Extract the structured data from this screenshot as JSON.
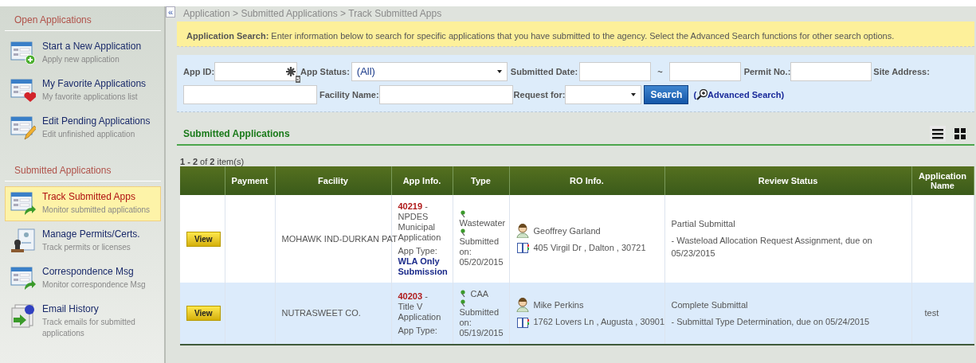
{
  "sidebar": {
    "sections": [
      {
        "title": "Open Applications",
        "items": [
          {
            "kind": "add",
            "title": "Start a New Application",
            "subtitle": "Apply new application",
            "selected": false
          },
          {
            "kind": "favorite",
            "title": "My Favorite Applications",
            "subtitle": "My favorite applications list",
            "selected": false
          },
          {
            "kind": "edit",
            "title": "Edit Pending Applications",
            "subtitle": "Edit unfinished application",
            "selected": false
          }
        ]
      },
      {
        "title": "Submitted Applications",
        "items": [
          {
            "kind": "track",
            "title": "Track Submitted Apps",
            "subtitle": "Monitor submitted applications",
            "selected": true
          },
          {
            "kind": "permit",
            "title": "Manage Permits/Certs.",
            "subtitle": "Track permits or licenses",
            "selected": false
          },
          {
            "kind": "track",
            "title": "Correspondence Msg",
            "subtitle": "Monitor correspondence Msg",
            "selected": false
          },
          {
            "kind": "email",
            "title": "Email History",
            "subtitle": "Track emails for submitted applications",
            "selected": false
          }
        ]
      }
    ]
  },
  "collapse_button": "«",
  "breadcrumb": "Application > Submitted Applications > Track Submitted Apps",
  "notice": "**Application Search:** Enter information below to search for specific applications that you have submitted to the agency. Select the Advanced Search functions for other search options.",
  "search": {
    "app_id_label": "App ID:",
    "app_id_badge": "5",
    "app_status_label": "App Status:",
    "app_status_value": "(All)",
    "submitted_date_label": "Submitted Date:",
    "date_separator": "~",
    "permit_no_label": "Permit No.:",
    "site_address_label": "Site Address:",
    "facility_name_label": "Facility Name:",
    "request_for_label": "Request for:",
    "search_button": "Search",
    "open_paren": "(",
    "advanced_search": "Advanced Search",
    "close_paren": ")"
  },
  "section_title": "Submitted Applications",
  "item_count": "**1 - 2** of **2** item(s)",
  "table": {
    "columns": [
      "",
      "Payment",
      "Facility",
      "App Info.",
      "Type",
      "RO Info.",
      "Review Status",
      "Application Name"
    ],
    "rows": [
      {
        "action": "View",
        "facility": "MOHAWK IND-DURKAN PAT",
        "app_id": "40219",
        "app_title": " - NPDES Municipal Application",
        "app_type_label": "App Type:",
        "app_type": "WLA Only Submission",
        "type": "Wastewater",
        "submitted": "Submitted on: 05/20/2015",
        "ro_name": "Geoffrey Garland",
        "ro_address": "405 Virgil Dr , Dalton , 30721",
        "review_status": "Partial Submittal",
        "review_detail": "- Wasteload Allocation Request Assignment, due on 05/23/2015"
      },
      {
        "action": "View",
        "facility": "NUTRASWEET CO.",
        "app_id": "40203",
        "app_title": " - Title V Application",
        "app_type_label": "App Type:",
        "type": "CAA",
        "submitted": "Submitted on: 05/19/2015",
        "ro_name": "Mike Perkins",
        "ro_address": "1762 Lovers Ln , Augusta , 30901",
        "review_status": "Complete Submittal",
        "review_detail": "- Submittal Type Determination, due on 05/24/2015",
        "application_name": "test"
      }
    ]
  }
}
